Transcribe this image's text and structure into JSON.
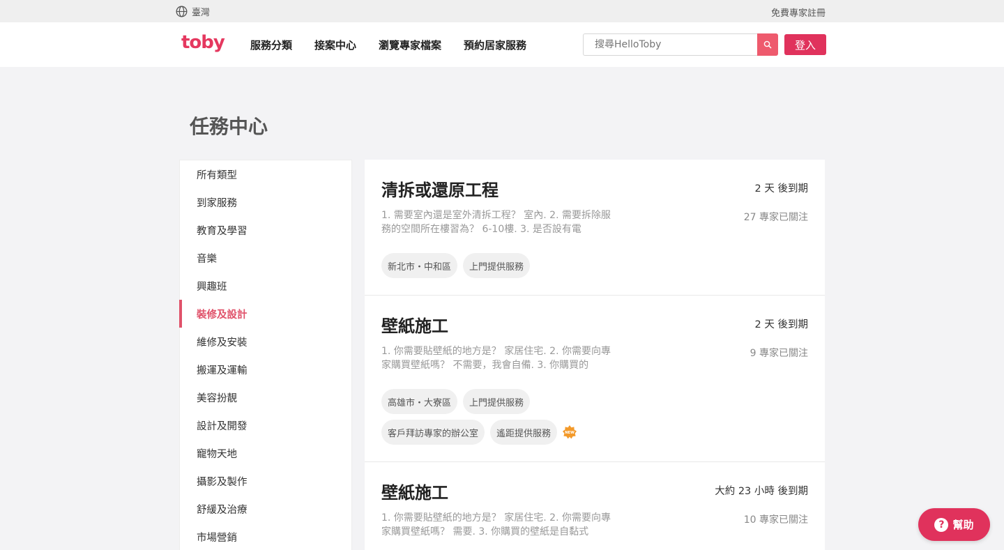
{
  "topbar": {
    "region": "臺灣",
    "register": "免費專家註冊",
    "globe_icon": "globe-icon"
  },
  "navbar": {
    "logo": "toby",
    "links": [
      "服務分類",
      "接案中心",
      "瀏覽專家檔案",
      "預約居家服務"
    ],
    "search_placeholder": "搜尋HelloToby",
    "search_icon": "search-icon",
    "login": "登入"
  },
  "page": {
    "title": "任務中心"
  },
  "sidebar": {
    "active_index": 5,
    "items": [
      {
        "label": "所有類型"
      },
      {
        "label": "到家服務"
      },
      {
        "label": "教育及學習"
      },
      {
        "label": "音樂"
      },
      {
        "label": "興趣班"
      },
      {
        "label": "裝修及設計"
      },
      {
        "label": "維修及安裝"
      },
      {
        "label": "搬運及運輸"
      },
      {
        "label": "美容扮靚"
      },
      {
        "label": "設計及開發"
      },
      {
        "label": "寵物天地"
      },
      {
        "label": "攝影及製作"
      },
      {
        "label": "舒緩及治療"
      },
      {
        "label": "市場營銷"
      }
    ]
  },
  "feed": {
    "cards": [
      {
        "title": "清拆或還原工程",
        "expire": "2 天 後到期",
        "followers": "27 專家已關注",
        "description": "1. 需要室內還是室外清拆工程？ 室內. 2. 需要拆除服務的空間所在樓習為？ 6-10樓. 3. 是否設有電",
        "tags": [
          "新北市・中和區",
          "上門提供服務"
        ]
      },
      {
        "title": "壁紙施工",
        "expire": "2 天 後到期",
        "followers": "9 專家已關注",
        "description": "1. 你需要貼壁紙的地方是？ 家居住宅. 2. 你需要向專家購買壁紙嗎？ 不需要，我會自備. 3. 你購買的",
        "tags": [
          "高雄市・大寮區",
          "上門提供服務",
          "客戶拜訪專家的辦公室",
          "遙距提供服務"
        ],
        "new_badge": "NEW"
      },
      {
        "title": "壁紙施工",
        "expire": "大約 23 小時 後到期",
        "followers": "10 專家已關注",
        "description": "1. 你需要貼壁紙的地方是？ 家居住宅. 2. 你需要向專家購買壁紙嗎？ 需要. 3. 你購買的壁紙是自黏式",
        "tags": []
      }
    ]
  },
  "help": {
    "label": "幫助",
    "icon": "question-icon"
  },
  "colors": {
    "brand": "#e0325c",
    "search_button": "#ee5a6d",
    "active_sidebar": "#e0526a",
    "background": "#f3f3f5"
  }
}
